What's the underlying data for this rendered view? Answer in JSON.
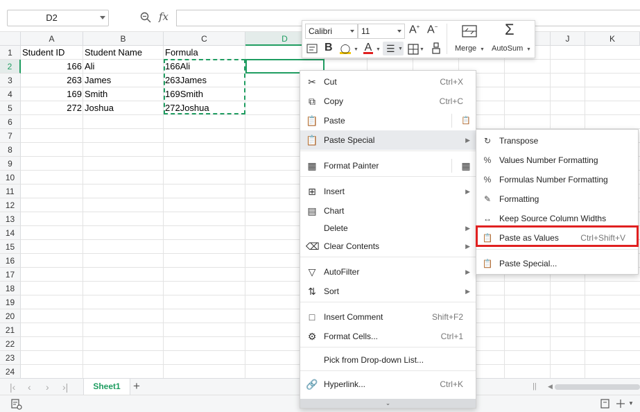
{
  "name_box": {
    "value": "D2"
  },
  "formula_bar": {
    "fx": "fx",
    "value": ""
  },
  "columns": [
    "A",
    "B",
    "C",
    "D",
    "",
    "",
    "",
    "",
    "J",
    "K"
  ],
  "rows": [
    "1",
    "2",
    "3",
    "4",
    "5",
    "6",
    "7",
    "8",
    "9",
    "10",
    "11",
    "12",
    "13",
    "14",
    "15",
    "16",
    "17",
    "18",
    "19",
    "20",
    "21",
    "22",
    "23",
    "24"
  ],
  "sheet": {
    "headers": [
      "Student ID",
      "Student Name",
      "Formula"
    ],
    "data": [
      {
        "id": "166",
        "name": "Ali",
        "formula": "166Ali"
      },
      {
        "id": "263",
        "name": "James",
        "formula": "263James"
      },
      {
        "id": "169",
        "name": "Smith",
        "formula": "169Smith"
      },
      {
        "id": "272",
        "name": "Joshua",
        "formula": "272Joshua"
      }
    ]
  },
  "mini_toolbar": {
    "font": "Calibri",
    "size": "11",
    "merge": "Merge",
    "autosum": "AutoSum"
  },
  "context_menu": {
    "cut": {
      "label": "Cut",
      "shortcut": "Ctrl+X"
    },
    "copy": {
      "label": "Copy",
      "shortcut": "Ctrl+C"
    },
    "paste": {
      "label": "Paste"
    },
    "paste_special": {
      "label": "Paste Special"
    },
    "format_painter": {
      "label": "Format Painter"
    },
    "insert": {
      "label": "Insert"
    },
    "chart": {
      "label": "Chart"
    },
    "delete": {
      "label": "Delete"
    },
    "clear_contents": {
      "label": "Clear Contents"
    },
    "autofilter": {
      "label": "AutoFilter"
    },
    "sort": {
      "label": "Sort"
    },
    "insert_comment": {
      "label": "Insert Comment",
      "shortcut": "Shift+F2"
    },
    "format_cells": {
      "label": "Format Cells...",
      "shortcut": "Ctrl+1"
    },
    "pick_list": {
      "label": "Pick from Drop-down List..."
    },
    "hyperlink": {
      "label": "Hyperlink...",
      "shortcut": "Ctrl+K"
    }
  },
  "submenu": {
    "transpose": "Transpose",
    "values_number_formatting": "Values Number Formatting",
    "formulas_number_formatting": "Formulas Number Formatting",
    "formatting": "Formatting",
    "keep_source_widths": "Keep Source Column Widths",
    "paste_as_values": {
      "label": "Paste as Values",
      "shortcut": "Ctrl+Shift+V"
    },
    "paste_special": "Paste Special..."
  },
  "tabs": {
    "active": "Sheet1"
  },
  "colors": {
    "accent": "#1f9d61",
    "highlight_box": "#e02020"
  }
}
